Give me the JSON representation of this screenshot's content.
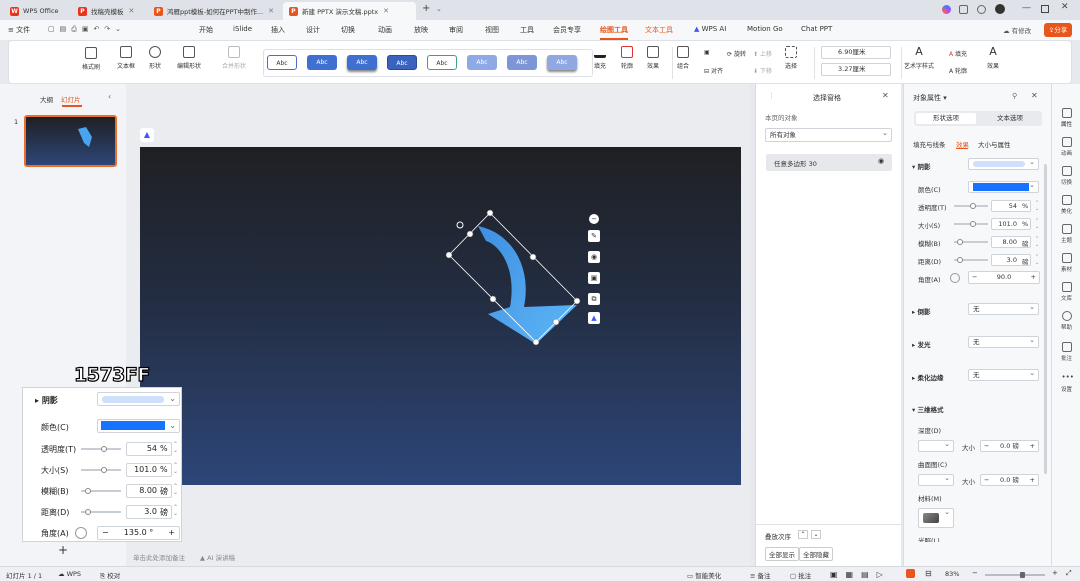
{
  "titlebar": {
    "tabs": [
      {
        "label": "WPS Office",
        "color": "#e8351c"
      },
      {
        "label": "找稿壳模板",
        "color": "#e8351c"
      },
      {
        "label": "鸿雁ppt模板-如何在PPT中制作...",
        "color": "#e8561c"
      },
      {
        "label": "新建 PPTX 演示文稿.pptx",
        "color": "#e8561c"
      }
    ],
    "new_tab": "+",
    "unsaved_label": "有修改",
    "share_label": "分享"
  },
  "menubar": {
    "file": "文件",
    "items": [
      "开始",
      "iSlide",
      "插入",
      "设计",
      "切换",
      "动画",
      "放映",
      "审阅",
      "视图",
      "工具",
      "会员专享",
      "绘图工具",
      "文本工具",
      "WPS AI",
      "Motion Go",
      "Chat PPT"
    ],
    "active": "绘图工具"
  },
  "ribbon": {
    "format_painter": "格式刷",
    "textbox": "文本框",
    "shape": "形状",
    "edit_shape": "编辑形状",
    "merge_shape": "合并形状",
    "style_label": "Abc",
    "fill": "填充",
    "outline": "轮廓",
    "effect": "效果",
    "group": "组合",
    "align": "对齐",
    "rotate": "旋转",
    "up": "上移",
    "down": "下移",
    "select": "选择",
    "width": "6.90厘米",
    "height": "3.27厘米",
    "art_text": "艺术字样式",
    "text_fill": "填充",
    "text_outline": "轮廓",
    "text_effect": "效果"
  },
  "leftpanel": {
    "tab_outline": "大纲",
    "tab_slides": "幻灯片",
    "slide_number": "1"
  },
  "notes_placeholder": "单击此处添加备注",
  "ai_notes": "AI 演讲稿",
  "selection_pane": {
    "title": "选择窗格",
    "page_objects": "本页的对象",
    "filter": "所有对象",
    "item": "任意多边形 30",
    "order_label": "叠放次序",
    "show_all": "全部显示",
    "hide_all": "全部隐藏"
  },
  "props": {
    "title": "对象属性",
    "tab_shape": "形状选项",
    "tab_text": "文本选项",
    "sub_fill": "填充与线条",
    "sub_effect": "效果",
    "sub_size": "大小与属性",
    "shadow": "阴影",
    "color": "颜色(C)",
    "color_value": "#1573FF",
    "transparency": "透明度(T)",
    "transparency_value": "54",
    "transparency_unit": "%",
    "size": "大小(S)",
    "size_value": "101.0",
    "size_unit": "%",
    "blur": "模糊(B)",
    "blur_value": "8.00",
    "blur_unit": "磅",
    "distance": "距离(D)",
    "distance_value": "3.0",
    "distance_unit": "磅",
    "angle": "角度(A)",
    "angle_value": "90.0",
    "reflection": "倒影",
    "glow": "发光",
    "soft_edge": "柔化边缘",
    "none": "无",
    "threed": "三维格式",
    "depth": "深度(D)",
    "contour": "曲面图(C)",
    "size_label": "大小",
    "zero_pt": "0.0",
    "pt": "磅",
    "material": "材料(M)",
    "lighting": "光照(L)"
  },
  "rightbar": [
    "属性",
    "动画",
    "切换",
    "美化",
    "主题",
    "素材",
    "文库",
    "帮助",
    "批注",
    "设置"
  ],
  "overlay": {
    "hex_label": "1573FF",
    "shadow": "阴影",
    "color": "颜色(C)",
    "transparency": "透明度(T)",
    "transparency_value": "54",
    "size": "大小(S)",
    "size_value": "101.0",
    "blur": "模糊(B)",
    "blur_value": "8.00",
    "distance": "距离(D)",
    "distance_value": "3.0",
    "angle": "角度(A)",
    "angle_value": "135.0",
    "unit_pct": "%",
    "unit_pt": "磅",
    "unit_deg": "°"
  },
  "status": {
    "slide_info": "幻灯片 1 / 1",
    "wps": "WPS",
    "proof": "校对",
    "beautify": "智能美化",
    "notes": "备注",
    "annotate": "批注",
    "zoom": "83%"
  }
}
